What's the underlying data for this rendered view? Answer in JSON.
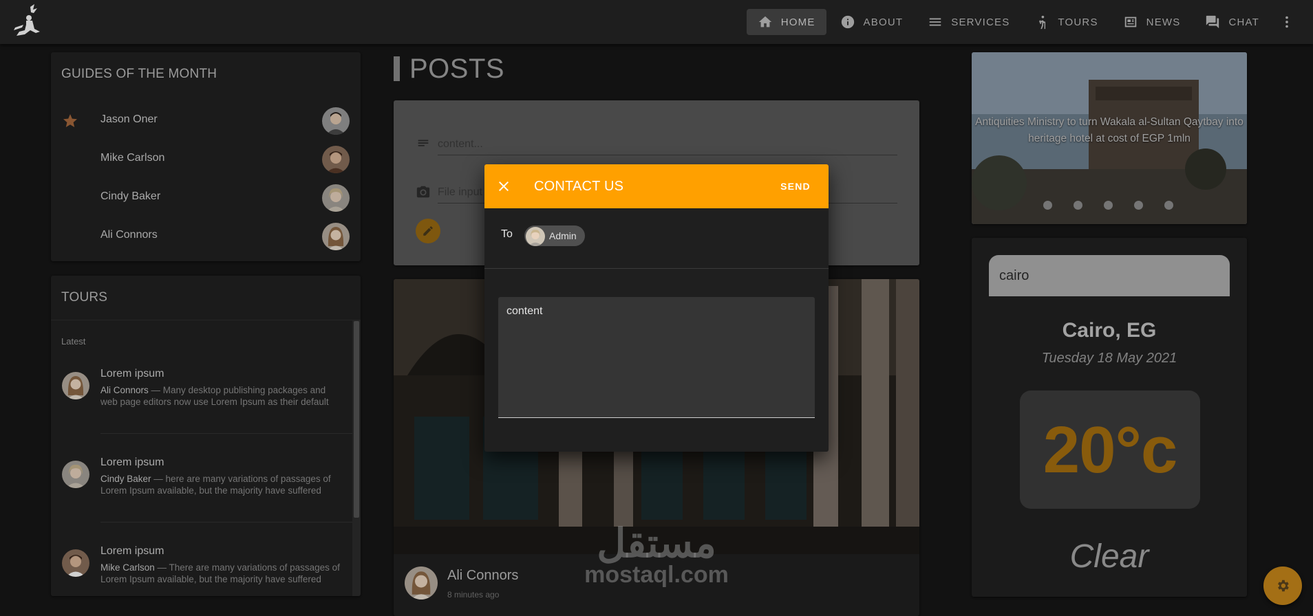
{
  "nav": {
    "items": [
      {
        "label": "HOME",
        "icon": "home-icon",
        "active": true
      },
      {
        "label": "ABOUT",
        "icon": "info-icon"
      },
      {
        "label": "SERVICES",
        "icon": "menu-lines-icon"
      },
      {
        "label": "TOURS",
        "icon": "hiking-icon"
      },
      {
        "label": "NEWS",
        "icon": "newspaper-icon"
      },
      {
        "label": "CHAT",
        "icon": "forum-icon"
      }
    ],
    "more_icon": "more-vertical-icon"
  },
  "guides": {
    "title": "GUIDES OF THE MONTH",
    "items": [
      {
        "name": "Jason Oner",
        "starred": true
      },
      {
        "name": "Mike Carlson"
      },
      {
        "name": "Cindy Baker"
      },
      {
        "name": "Ali Connors"
      }
    ]
  },
  "tours": {
    "title": "TOURS",
    "subheader": "Latest",
    "items": [
      {
        "title": "Lorem ipsum",
        "author": "Ali Connors",
        "text": " — Many desktop publishing packages and web page editors now use Lorem Ipsum as their default model text"
      },
      {
        "title": "Lorem ipsum",
        "author": "Cindy Baker",
        "text": " — here are many variations of passages of Lorem Ipsum available, but the majority have suffered alteration"
      },
      {
        "title": "Lorem ipsum",
        "author": "Mike Carlson",
        "text": " — There are many variations of passages of Lorem Ipsum available, but the majority have suffered alteration"
      }
    ]
  },
  "posts": {
    "title": "POSTS",
    "content_placeholder": "content...",
    "file_placeholder": "File input",
    "post": {
      "author": "Ali Connors",
      "time": "8 minutes ago"
    }
  },
  "news": {
    "caption": "Antiquities Ministry to turn Wakala al-Sultan Qaytbay into heritage hotel at cost of EGP 1mln",
    "slide_count": 5
  },
  "weather": {
    "search_value": "cairo",
    "city": "Cairo, EG",
    "date": "Tuesday 18 May 2021",
    "temperature": "20°c",
    "condition": "Clear"
  },
  "dialog": {
    "title": "CONTACT US",
    "send_label": "SEND",
    "to_label": "To",
    "recipient": "Admin",
    "message": "content"
  },
  "watermark": {
    "arabic": "مستقل",
    "latin": "mostaql.com"
  },
  "colors": {
    "accent": "#ffa000",
    "background": "#161616",
    "card": "#212121"
  }
}
